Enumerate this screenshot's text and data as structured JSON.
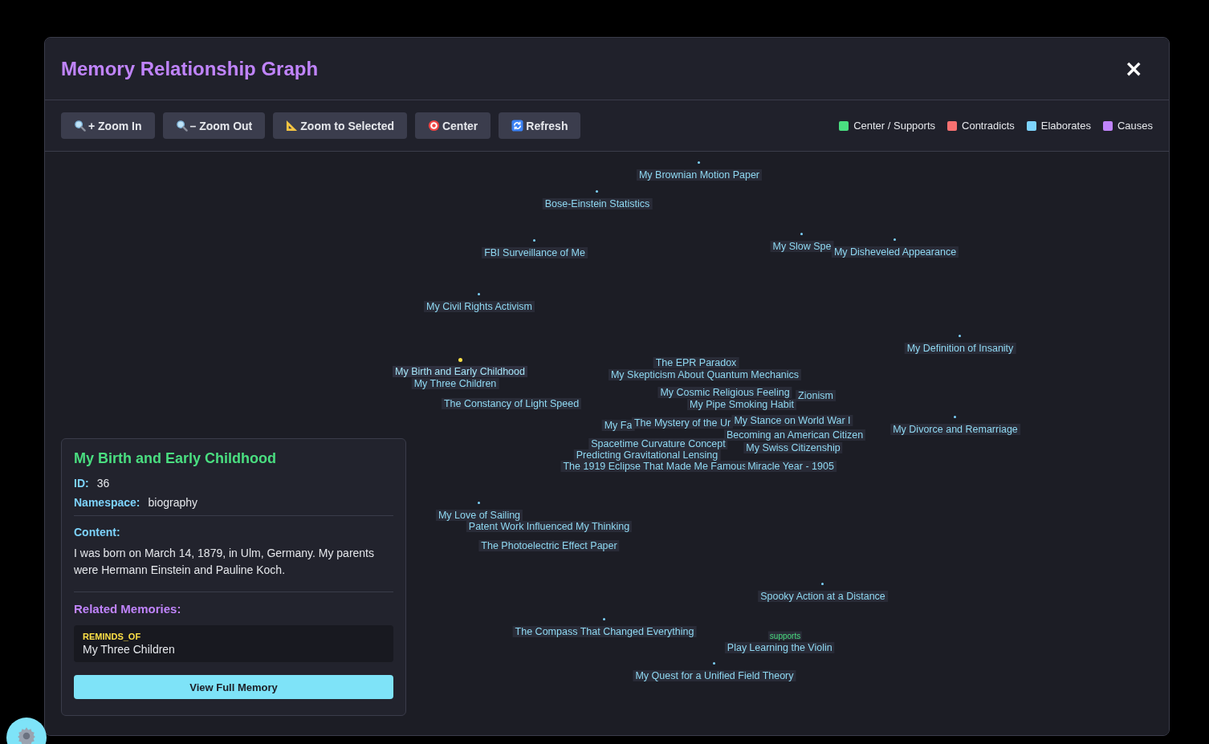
{
  "dialog": {
    "title": "Memory Relationship Graph",
    "close": "×"
  },
  "toolbar": {
    "buttons": [
      {
        "label": "+ Zoom In",
        "kind": "zoom-in"
      },
      {
        "label": "– Zoom Out",
        "kind": "zoom-out"
      },
      {
        "label": "Zoom to Selected",
        "kind": "ruler"
      },
      {
        "label": "Center",
        "kind": "target"
      },
      {
        "label": "Refresh",
        "kind": "refresh"
      }
    ],
    "legend": [
      {
        "label": "Center / Supports",
        "color": "#4ade80"
      },
      {
        "label": "Contradicts",
        "color": "#f87171"
      },
      {
        "label": "Elaborates",
        "color": "#7dd3fc"
      },
      {
        "label": "Causes",
        "color": "#c084fc"
      }
    ]
  },
  "graph": {
    "nodes": [
      {
        "label": "My Brownian Motion Paper",
        "selected": false
      },
      {
        "label": "Bose-Einstein Statistics",
        "selected": false
      },
      {
        "label": "FBI Surveillance of Me",
        "selected": false
      },
      {
        "label": "My Slow Spe",
        "selected": false
      },
      {
        "label": "My Disheveled Appearance",
        "selected": false
      },
      {
        "label": "My Civil Rights Activism",
        "selected": false
      },
      {
        "label": "My Definition of Insanity",
        "selected": false
      },
      {
        "label": "The EPR Paradox",
        "selected": false
      },
      {
        "label": "My Birth and Early Childhood",
        "selected": true
      },
      {
        "label": "My Skepticism About Quantum Mechanics",
        "selected": false
      },
      {
        "label": "My Three Children",
        "selected": false
      },
      {
        "label": "My Cosmic Religious Feeling",
        "selected": false
      },
      {
        "label": "Zionism",
        "selected": false
      },
      {
        "label": "The Constancy of Light Speed",
        "selected": false
      },
      {
        "label": "My Pipe Smoking Habit",
        "selected": false
      },
      {
        "label": "My Fa",
        "selected": false
      },
      {
        "label": "The Mystery of the Ur",
        "selected": false
      },
      {
        "label": "My Stance on World War I",
        "selected": false
      },
      {
        "label": "My Divorce and Remarriage",
        "selected": false
      },
      {
        "label": "Becoming an American Citizen",
        "selected": false
      },
      {
        "label": "Spacetime Curvature Concept",
        "selected": false
      },
      {
        "label": "My Swiss Citizenship",
        "selected": false
      },
      {
        "label": "Predicting Gravitational Lensing",
        "selected": false
      },
      {
        "label": "The 1919 Eclipse That Made Me Famous",
        "selected": false
      },
      {
        "label": "Miracle Year - 1905",
        "selected": false
      },
      {
        "label": "My Love of Sailing",
        "selected": false
      },
      {
        "label": "Patent Work Influenced My Thinking",
        "selected": false
      },
      {
        "label": "The Photoelectric Effect Paper",
        "selected": false
      },
      {
        "label": "Spooky Action at a Distance",
        "selected": false
      },
      {
        "label": "The Compass That Changed Everything",
        "selected": false
      },
      {
        "label": "Play",
        "selected": false
      },
      {
        "label": "Learning the Violin",
        "selected": false
      },
      {
        "label": "My Quest for a Unified Field Theory",
        "selected": false
      }
    ],
    "edge_labels": [
      {
        "text": "supports",
        "kind": "supports"
      }
    ]
  },
  "details": {
    "title": "My Birth and Early Childhood",
    "fields": [
      {
        "label": "ID:",
        "value": "36"
      },
      {
        "label": "Namespace:",
        "value": "biography"
      }
    ],
    "content_label": "Content:",
    "content": "I was born on March 14, 1879, in Ulm, Germany. My parents were Hermann Einstein and Pauline Koch.",
    "related_label": "Related Memories:",
    "related": [
      {
        "relation": "REMINDS_OF",
        "title": "My Three Children"
      }
    ],
    "button": "View Full Memory"
  }
}
